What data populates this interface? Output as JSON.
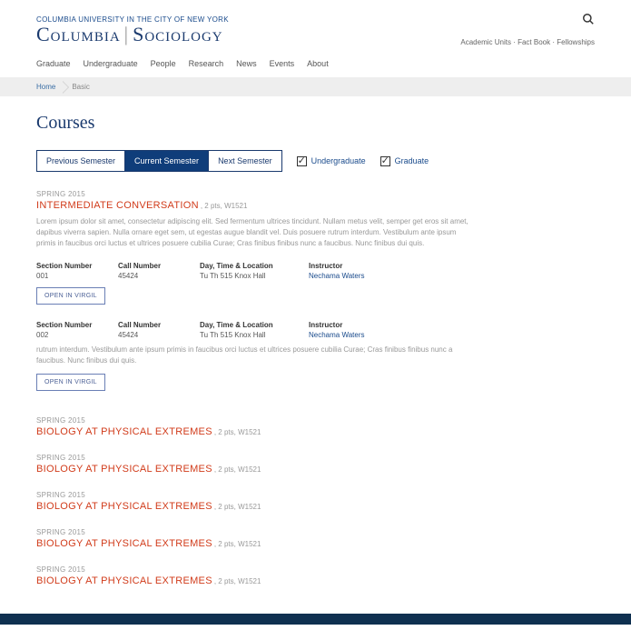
{
  "topbar": {
    "university_name": "COLUMBIA UNIVERSITY IN THE CITY OF NEW YORK"
  },
  "secondary_nav": {
    "items": [
      "Academic Units",
      "Fact Book",
      "Fellowships"
    ]
  },
  "logo": {
    "part1": "Columbia",
    "part2": "Sociology"
  },
  "main_nav": {
    "items": [
      "Graduate",
      "Undergraduate",
      "People",
      "Research",
      "News",
      "Events",
      "About"
    ]
  },
  "breadcrumb": {
    "home": "Home",
    "current": "Basic"
  },
  "page_title": "Courses",
  "semester_tabs": {
    "prev": "Previous Semester",
    "current": "Current Semester",
    "next": "Next Semester"
  },
  "level_filters": {
    "undergrad": "Undergraduate",
    "grad": "Graduate"
  },
  "section_labels": {
    "section_number": "Section Number",
    "call_number": "Call Number",
    "day_time_loc": "Day, Time & Location",
    "instructor": "Instructor"
  },
  "virgil_button": "OPEN IN VIRGIL",
  "courses": [
    {
      "term": "SPRING 2015",
      "title": "INTERMEDIATE CONVERSATION",
      "meta": ", 2 pts, W1521",
      "description": "Lorem ipsum dolor sit amet, consectetur adipiscing elit. Sed fermentum ultrices tincidunt. Nullam metus velit, semper get eros sit amet, dapibus viverra sapien. Nulla ornare eget sem, ut egestas augue blandit vel. Duis posuere rutrum interdum.  Vestibulum ante ipsum primis in faucibus orci luctus et ultrices posuere cubilia Curae; Cras finibus finibus nunc a faucibus. Nunc finibus dui quis.",
      "sections": [
        {
          "number": "001",
          "call": "45424",
          "dtl": "Tu Th  515 Knox Hall",
          "instructor": "Nechama Waters"
        },
        {
          "number": "002",
          "call": "45424",
          "dtl": "Tu Th  515 Knox Hall",
          "instructor": "Nechama Waters",
          "note": "rutrum interdum.  Vestibulum ante ipsum primis in faucibus orci luctus et ultrices posuere cubilia Curae; Cras finibus finibus nunc a faucibus. Nunc finibus dui quis."
        }
      ]
    },
    {
      "term": "SPRING 2015",
      "title": "BIOLOGY AT PHYSICAL EXTREMES",
      "meta": ", 2 pts, W1521"
    },
    {
      "term": "SPRING 2015",
      "title": "BIOLOGY AT PHYSICAL EXTREMES",
      "meta": ", 2 pts, W1521"
    },
    {
      "term": "SPRING 2015",
      "title": "BIOLOGY AT PHYSICAL EXTREMES",
      "meta": ", 2 pts, W1521"
    },
    {
      "term": "SPRING 2015",
      "title": "BIOLOGY AT PHYSICAL EXTREMES",
      "meta": ", 2 pts, W1521"
    },
    {
      "term": "SPRING 2015",
      "title": "BIOLOGY AT PHYSICAL EXTREMES",
      "meta": ", 2 pts, W1521"
    }
  ]
}
